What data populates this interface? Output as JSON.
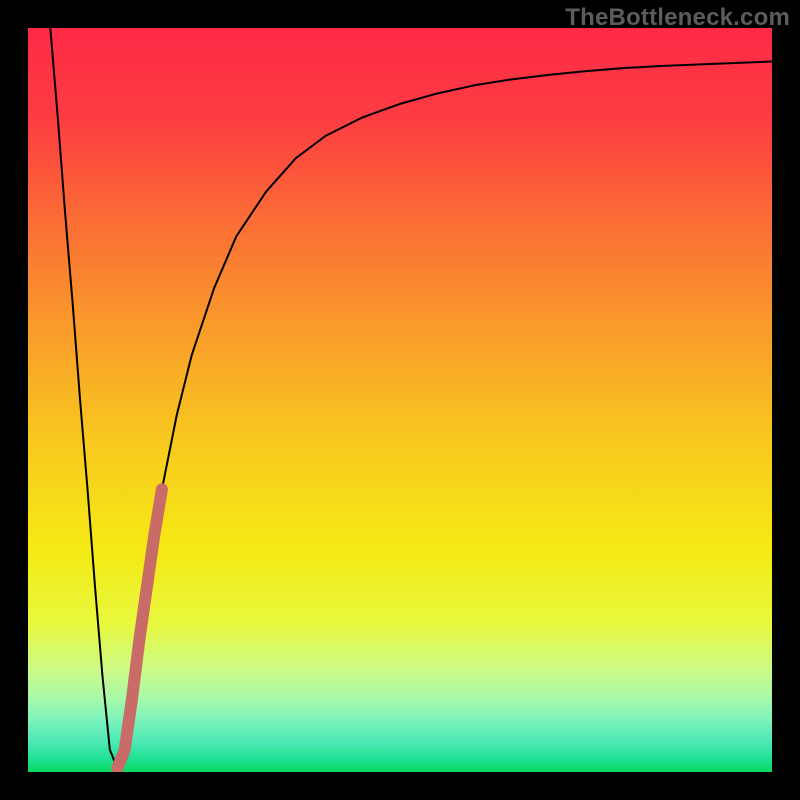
{
  "watermark": "TheBottleneck.com",
  "chart_data": {
    "type": "line",
    "title": "",
    "xlabel": "",
    "ylabel": "",
    "xlim": [
      0,
      100
    ],
    "ylim": [
      0,
      100
    ],
    "grid": false,
    "series": [
      {
        "name": "main-curve",
        "color": "#000000",
        "width": 2,
        "x": [
          3,
          4,
          5,
          6,
          7,
          8,
          9,
          10,
          11,
          12,
          13,
          14,
          15,
          16,
          18,
          20,
          22,
          25,
          28,
          32,
          36,
          40,
          45,
          50,
          55,
          60,
          65,
          70,
          75,
          80,
          85,
          90,
          95,
          100
        ],
        "values": [
          100,
          88,
          75,
          63,
          50,
          38,
          25,
          13,
          3,
          0.5,
          3,
          10,
          18,
          25,
          38,
          48,
          56,
          65,
          72,
          78,
          82.5,
          85.5,
          88,
          89.8,
          91.2,
          92.3,
          93.1,
          93.7,
          94.2,
          94.6,
          94.9,
          95.1,
          95.3,
          95.5
        ]
      },
      {
        "name": "highlight-segment",
        "color": "#c96b66",
        "width": 12,
        "x": [
          12,
          13,
          14,
          15,
          16,
          17,
          18
        ],
        "values": [
          0.5,
          3,
          10,
          18,
          25,
          32,
          38
        ]
      }
    ],
    "background_gradient": {
      "type": "vertical",
      "stops": [
        {
          "pos": 0.0,
          "color": "#fd2a46"
        },
        {
          "pos": 0.12,
          "color": "#fd3c42"
        },
        {
          "pos": 0.25,
          "color": "#fb6a36"
        },
        {
          "pos": 0.4,
          "color": "#f99a2b"
        },
        {
          "pos": 0.55,
          "color": "#f8c71f"
        },
        {
          "pos": 0.7,
          "color": "#f5ea14"
        },
        {
          "pos": 0.8,
          "color": "#e8f83d"
        },
        {
          "pos": 0.86,
          "color": "#cdfb84"
        },
        {
          "pos": 0.9,
          "color": "#aaf9a8"
        },
        {
          "pos": 0.93,
          "color": "#7df2bb"
        },
        {
          "pos": 0.96,
          "color": "#4be9b4"
        },
        {
          "pos": 0.985,
          "color": "#1bdf8e"
        },
        {
          "pos": 1.0,
          "color": "#09d95f"
        }
      ]
    }
  }
}
